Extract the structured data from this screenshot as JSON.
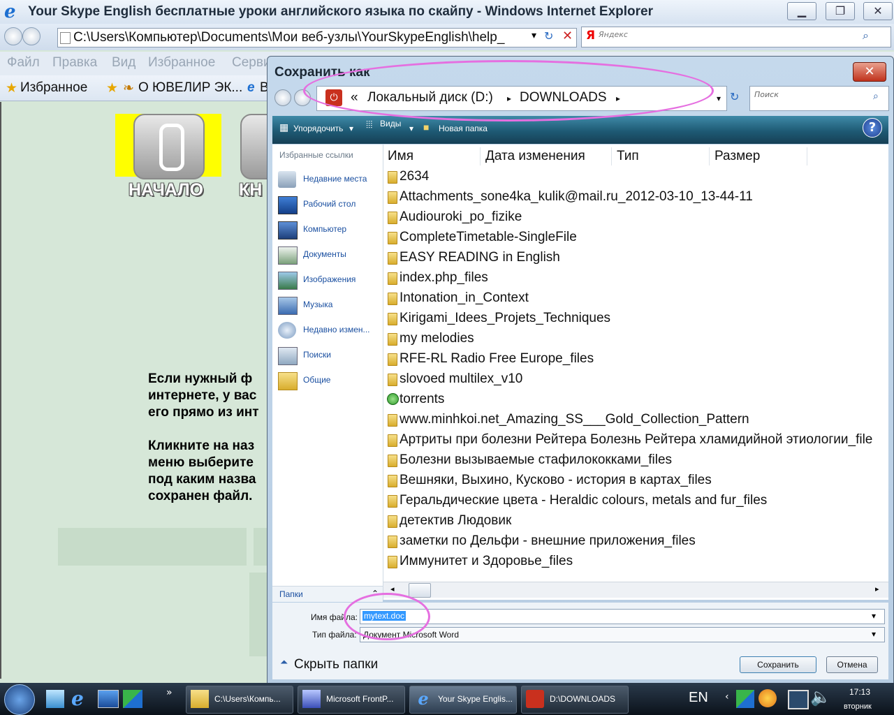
{
  "window": {
    "title": "Your Skype English бесплатные уроки английского языка по скайпу - Windows Internet Explorer"
  },
  "address": {
    "url": "C:\\Users\\Компьютер\\Documents\\Мои веб-узлы\\YourSkypeEnglish\\help_",
    "search_placeholder": "Яндекс"
  },
  "menu": {
    "items": [
      "Файл",
      "Правка",
      "Вид",
      "Избранное",
      "Серви"
    ]
  },
  "favbar": {
    "favorites": "Избранное",
    "link1": "О ЮВЕЛИР ЭК...",
    "link2": "В"
  },
  "page": {
    "nav": [
      "НАЧАЛО",
      "КН"
    ],
    "para1": [
      "Если нужный ф",
      "интернете, у вас",
      "его прямо из инт"
    ],
    "para2": [
      "Кликните на наз",
      "меню выберите",
      "под каким назва",
      "сохранен файл."
    ]
  },
  "dialog": {
    "title": "Сохранить как",
    "breadcrumb": {
      "prefix": "«",
      "drive": "Локальный диск (D:)",
      "folder": "DOWNLOADS"
    },
    "search_placeholder": "Поиск",
    "toolbar": {
      "organize": "Упорядочить",
      "views": "Виды",
      "new_folder": "Новая папка"
    },
    "favorites_header": "Избранные ссылки",
    "favorites": [
      "Недавние места",
      "Рабочий стол",
      "Компьютер",
      "Документы",
      "Изображения",
      "Музыка",
      "Недавно измен...",
      "Поиски",
      "Общие"
    ],
    "folders_label": "Папки",
    "columns": [
      "Имя",
      "Дата изменения",
      "Тип",
      "Размер"
    ],
    "files": [
      "2634",
      "Attachments_sone4ka_kulik@mail.ru_2012-03-10_13-44-11",
      "Audiouroki_po_fizike",
      "CompleteTimetable-SingleFile",
      "EASY READING in English",
      "index.php_files",
      "Intonation_in_Context",
      "Kirigami_Idees_Projets_Techniques",
      "my melodies",
      "RFE-RL Radio Free Europe_files",
      "slovoed multilex_v10",
      "torrents",
      "www.minhkoi.net_Amazing_SS___Gold_Collection_Pattern",
      "Артриты при болезни Рейтера Болезнь Рейтера хламидийной этиологии_file",
      "Болезни вызываемые стафилококками_files",
      "Вешняки, Выхино, Кусково - история в картах_files",
      "Геральдические цвета - Heraldic colours, metals and fur_files",
      "детектив Людовик",
      "заметки по Дельфи - внешние приложения_files",
      "Иммунитет и Здоровье_files"
    ],
    "filename_label": "Имя файла:",
    "filename_value": "mytext.doc",
    "filetype_label": "Тип файла:",
    "filetype_value": "Документ Microsoft Word",
    "hide_folders": "Скрыть папки",
    "save": "Сохранить",
    "cancel": "Отмена"
  },
  "taskbar": {
    "items": [
      "C:\\Users\\Компь...",
      "Microsoft FrontP...",
      "Your Skype Englis...",
      "D:\\DOWNLOADS"
    ],
    "lang": "EN",
    "time": "17:13",
    "day": "вторник",
    "more": "»"
  }
}
